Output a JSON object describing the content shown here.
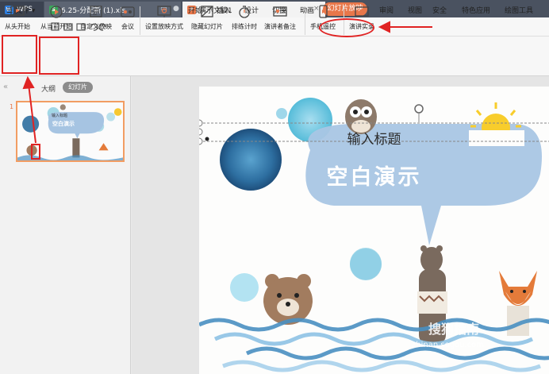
{
  "tabs": {
    "wps": "WPS",
    "xls": "6.25-分配新 (1).xls",
    "ppt": "演示文稿1",
    "new": "+"
  },
  "menu": {
    "file": "文件",
    "items": [
      "开始",
      "插入",
      "设计",
      "切换",
      "动画",
      "幻灯片放映",
      "审阅",
      "视图",
      "安全",
      "特色应用",
      "绘图工具"
    ]
  },
  "toolbar": {
    "buttons": [
      "从头开始",
      "从当前开始",
      "自定义放映",
      "会议",
      "设置放映方式",
      "隐藏幻灯片",
      "排练计时",
      "演讲者备注",
      "手机遥控",
      "演讲实录"
    ]
  },
  "pane": {
    "collapse": "«",
    "outline": "大纲",
    "slides": "幻灯片",
    "thumb_num": "1",
    "thumb_title": "输入标题",
    "thumb_subtitle": "空白演示"
  },
  "slide": {
    "title": "输入标题",
    "subtitle": "空白演示"
  },
  "watermark": {
    "text": "搜狗指南",
    "url": "zhinan.sogou.com"
  },
  "colors": {
    "accent": "#e8774a",
    "annotation": "#e02323",
    "tabbar": "#4a5260"
  }
}
